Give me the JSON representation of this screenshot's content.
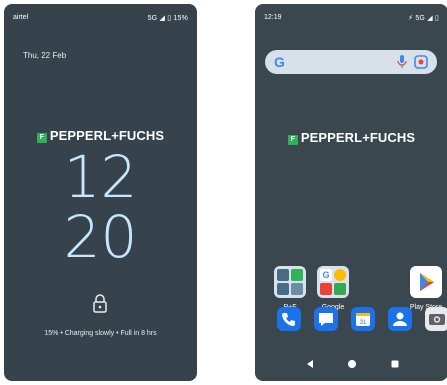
{
  "lock_screen": {
    "status_left": "airtel",
    "status_right": "5G ◢ ▯ 15%",
    "date": "Thu, 22 Feb",
    "brand": "PEPPERL+FUCHS",
    "clock_hours": "12",
    "clock_minutes": "20",
    "charging_text": "15% • Charging slowly • Full in 8 hrs",
    "icons": [
      "lock-icon"
    ]
  },
  "home_screen": {
    "status_left": "12:19",
    "status_right": "⚡ 5G ◢ ▯",
    "search": {
      "logo": "G",
      "icons": [
        "mic-icon",
        "lens-icon"
      ]
    },
    "brand": "PEPPERL+FUCHS",
    "apps": [
      {
        "label": "P+F",
        "icon": "pf-folder-icon"
      },
      {
        "label": "Google",
        "icon": "google-folder-icon"
      },
      {
        "label": "Play Store",
        "icon": "play-store-icon"
      }
    ],
    "dock": [
      {
        "icon": "phone-icon",
        "color": "#1a73e8"
      },
      {
        "icon": "messages-icon",
        "color": "#1a73e8"
      },
      {
        "icon": "calendar-icon",
        "color": "#1a73e8"
      },
      {
        "icon": "contacts-icon",
        "color": "#1a73e8"
      },
      {
        "icon": "camera-icon",
        "color": "#5f6368"
      }
    ],
    "nav": [
      "back-icon",
      "home-icon",
      "recents-icon"
    ]
  },
  "colors": {
    "brand_green": "#2fb356",
    "clock": "#c7e6ff",
    "lock_bg": "#36434c",
    "home_bg": "#3a474f"
  }
}
